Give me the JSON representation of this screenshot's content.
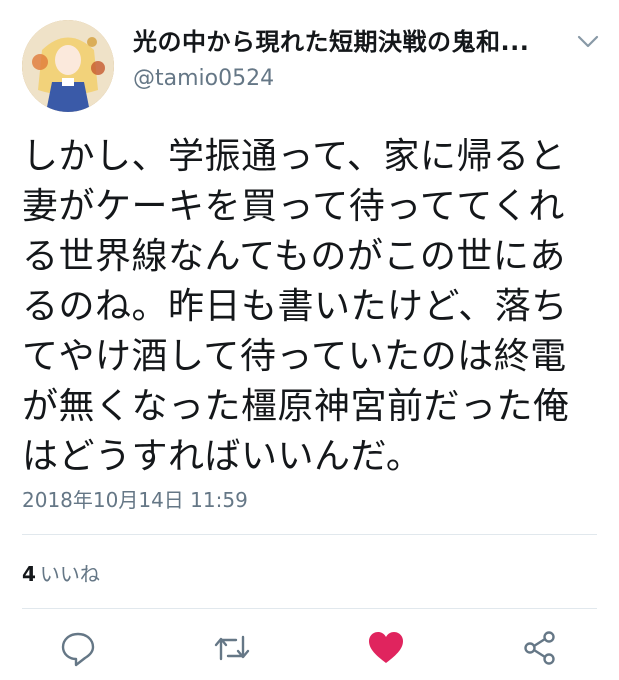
{
  "user": {
    "display_name": "光の中から現れた短期決戦の鬼和...",
    "handle": "@tamio0524"
  },
  "tweet": {
    "lines": [
      "しかし、学振通って、家に帰ると",
      "妻がケーキを買って待っててくれ",
      "る世界線なんてものがこの世にあ",
      "るのね。昨日も書いたけど、落ち",
      "てやけ酒して待っていたのは終電",
      "が無くなった橿原神宮前だった俺",
      "はどうすればいいんだ。"
    ],
    "timestamp": "2018年10月14日 11:59"
  },
  "stats": {
    "likes_count": "4",
    "likes_label": "いいね"
  },
  "actions": {
    "reply_icon": "reply-icon",
    "retweet_icon": "retweet-icon",
    "like_icon": "heart-icon",
    "share_icon": "share-icon"
  },
  "colors": {
    "text": "#14171a",
    "secondary": "#657786",
    "divider": "#e1e8ed",
    "like_active": "#e0245e",
    "icon": "#657786"
  }
}
